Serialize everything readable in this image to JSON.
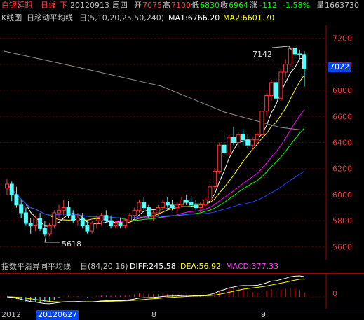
{
  "header": {
    "name": "白银延期",
    "period": "日线",
    "nav": "下",
    "date": "20120913",
    "weekday": "周四",
    "open_label": "开",
    "open": "7075",
    "high_label": "高",
    "high": "7100",
    "low_label": "低",
    "low": "6830",
    "close_label": "收",
    "close": "6964",
    "change_label": "涨",
    "change": "-112",
    "change_pct": "-1.58%",
    "volume_label": "量",
    "volume": "1663730"
  },
  "main_indicator": {
    "chart_label": "K线图",
    "ma_name": "日移动平均线",
    "ma_params": "日(5,10,20,25,50,240)",
    "ma1_text": "MA1:6766.20",
    "ma2_text": "MA2:6601.70"
  },
  "macd_indicator": {
    "name": "指数平滑异同平均线",
    "params": "日(84,20,16)",
    "diff_text": "DIFF:245.58",
    "dea_text": "DEA:56.92",
    "macd_text": "MACD:377.33"
  },
  "price_axis": {
    "ticks": [
      "7200",
      "7000",
      "6800",
      "6600",
      "6400",
      "6200",
      "6000",
      "5800",
      "5600"
    ],
    "current_price": "7022"
  },
  "macd_axis": {
    "ticks": [
      "0"
    ]
  },
  "annotations": {
    "high_mark": "7142",
    "low_mark": "5618"
  },
  "time_axis": {
    "year": "2012",
    "selected_date": "20120627",
    "month_8": "8",
    "month_9": "9"
  },
  "colors": {
    "up": "#ff3232",
    "down": "#54ffff",
    "ma1": "#ffffff",
    "ma2": "#ffff00",
    "ma3": "#ff00ff",
    "ma4": "#00ff00",
    "ma5": "#2040ff",
    "ma6": "#8c8c8c",
    "dea": "#ffff00",
    "macd": "#ff00ff"
  },
  "chart_data": {
    "type": "candlestick",
    "ylim": [
      5500,
      7300
    ],
    "candles": [
      [
        6050,
        6120,
        6000,
        6080
      ],
      [
        6080,
        6100,
        5950,
        6000
      ],
      [
        6000,
        6060,
        5900,
        5920
      ],
      [
        5920,
        5960,
        5820,
        5860
      ],
      [
        5860,
        5900,
        5760,
        5780
      ],
      [
        5780,
        5820,
        5700,
        5760
      ],
      [
        5760,
        5840,
        5720,
        5820
      ],
      [
        5820,
        5860,
        5720,
        5740
      ],
      [
        5740,
        5800,
        5680,
        5700
      ],
      [
        5700,
        5780,
        5680,
        5760
      ],
      [
        5760,
        5880,
        5740,
        5860
      ],
      [
        5860,
        5920,
        5820,
        5880
      ],
      [
        5880,
        5960,
        5840,
        5900
      ],
      [
        5900,
        5950,
        5820,
        5840
      ],
      [
        5840,
        5880,
        5780,
        5800
      ],
      [
        5800,
        5860,
        5760,
        5820
      ],
      [
        5820,
        5860,
        5740,
        5760
      ],
      [
        5760,
        5800,
        5700,
        5720
      ],
      [
        5720,
        5800,
        5700,
        5780
      ],
      [
        5780,
        5840,
        5740,
        5800
      ],
      [
        5800,
        5860,
        5760,
        5840
      ],
      [
        5840,
        5880,
        5780,
        5800
      ],
      [
        5800,
        5840,
        5740,
        5760
      ],
      [
        5760,
        5800,
        5740,
        5780
      ],
      [
        5780,
        5820,
        5740,
        5760
      ],
      [
        5760,
        5820,
        5740,
        5800
      ],
      [
        5800,
        5860,
        5780,
        5840
      ],
      [
        5840,
        5900,
        5820,
        5880
      ],
      [
        5880,
        5960,
        5860,
        5940
      ],
      [
        5940,
        5980,
        5880,
        5900
      ],
      [
        5900,
        5920,
        5820,
        5840
      ],
      [
        5840,
        5880,
        5800,
        5860
      ],
      [
        5860,
        5920,
        5840,
        5900
      ],
      [
        5900,
        5960,
        5880,
        5940
      ],
      [
        5940,
        5980,
        5900,
        5920
      ],
      [
        5920,
        5960,
        5880,
        5900
      ],
      [
        5900,
        5940,
        5860,
        5920
      ],
      [
        5920,
        5980,
        5900,
        5960
      ],
      [
        5960,
        6000,
        5920,
        5940
      ],
      [
        5940,
        5980,
        5900,
        5920
      ],
      [
        5920,
        5960,
        5880,
        5900
      ],
      [
        5900,
        5940,
        5860,
        5920
      ],
      [
        5920,
        5980,
        5900,
        5960
      ],
      [
        5960,
        6080,
        5940,
        6060
      ],
      [
        6060,
        6200,
        6040,
        6180
      ],
      [
        6180,
        6400,
        6160,
        6380
      ],
      [
        6380,
        6480,
        6300,
        6320
      ],
      [
        6320,
        6460,
        6300,
        6440
      ],
      [
        6440,
        6520,
        6380,
        6400
      ],
      [
        6400,
        6480,
        6360,
        6460
      ],
      [
        6460,
        6500,
        6380,
        6420
      ],
      [
        6420,
        6460,
        6360,
        6380
      ],
      [
        6380,
        6440,
        6340,
        6420
      ],
      [
        6420,
        6480,
        6380,
        6460
      ],
      [
        6460,
        6680,
        6440,
        6640
      ],
      [
        6640,
        6780,
        6600,
        6760
      ],
      [
        6760,
        6880,
        6720,
        6860
      ],
      [
        6860,
        6900,
        6700,
        6740
      ],
      [
        6740,
        6960,
        6720,
        6940
      ],
      [
        6940,
        7040,
        6900,
        7000
      ],
      [
        7000,
        7142,
        6980,
        7120
      ],
      [
        7120,
        7130,
        7060,
        7080
      ],
      [
        7080,
        7110,
        7040,
        7076
      ],
      [
        7075,
        7100,
        6830,
        6964
      ]
    ],
    "ma_series": [
      {
        "name": "MA1",
        "last": 6766.2
      },
      {
        "name": "MA2",
        "last": 6601.7
      }
    ],
    "macd": {
      "diff": 245.58,
      "dea": 56.92,
      "macd": 377.33
    }
  }
}
